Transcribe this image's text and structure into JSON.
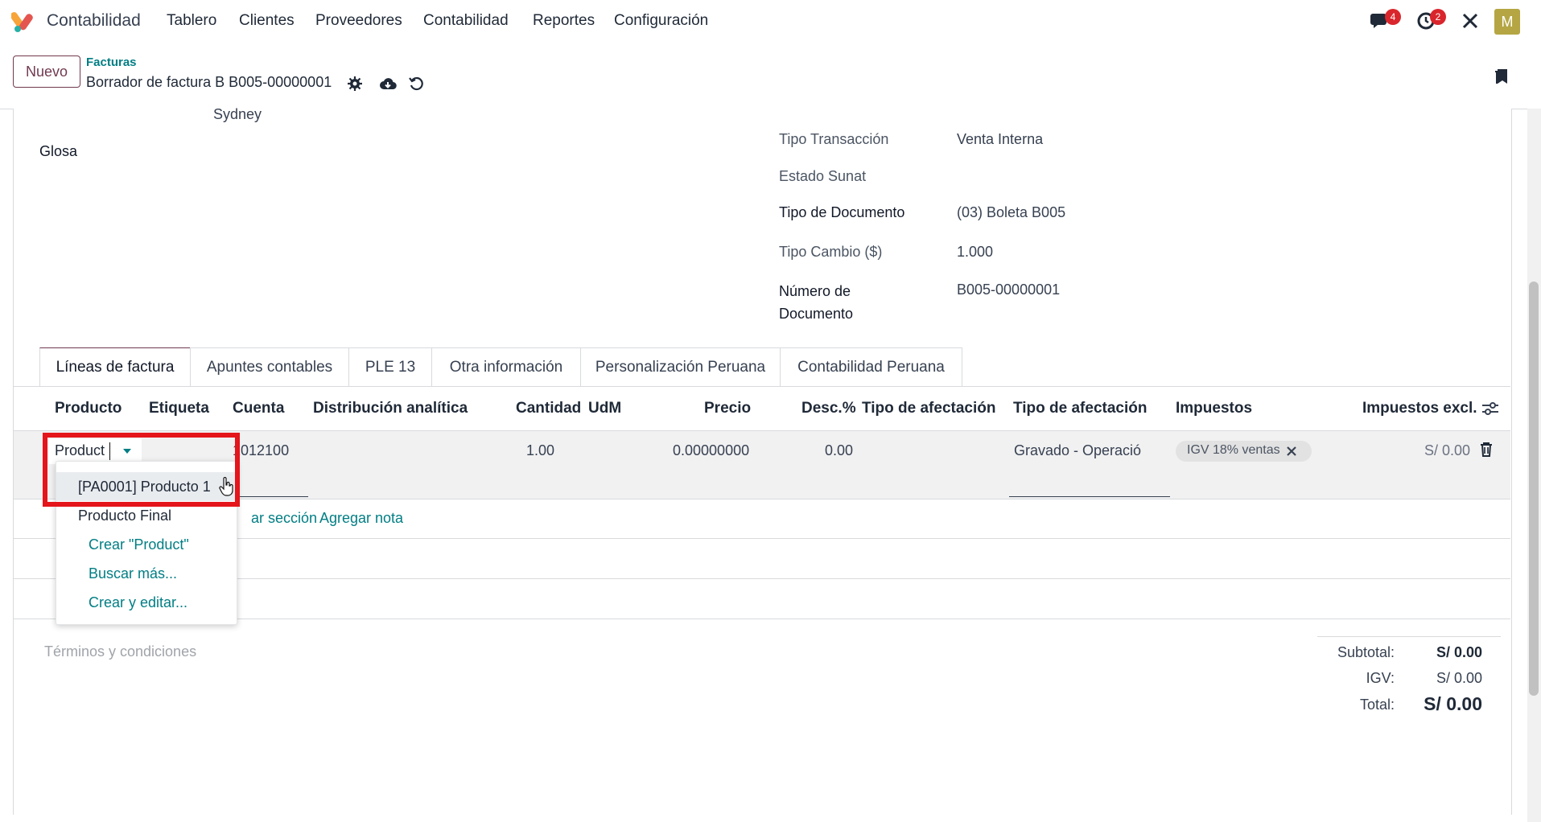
{
  "nav": {
    "app_name": "Contabilidad",
    "menu": [
      "Tablero",
      "Clientes",
      "Proveedores",
      "Contabilidad",
      "Reportes",
      "Configuración"
    ],
    "chat_badge": "4",
    "activity_badge": "2",
    "avatar_letter": "M"
  },
  "control": {
    "new_label": "Nuevo",
    "breadcrumb_parent": "Facturas",
    "record_title": "Borrador de factura B B005-00000001"
  },
  "form": {
    "city": "Sydney",
    "glosa_label": "Glosa",
    "fields": [
      {
        "label": "Tipo Transacción",
        "value": "Venta Interna"
      },
      {
        "label": "Estado Sunat",
        "value": ""
      },
      {
        "label": "Tipo de Documento",
        "value": "(03) Boleta B005"
      },
      {
        "label": "Tipo Cambio ($)",
        "value": "1.000"
      },
      {
        "label": "Número de Documento",
        "value": "B005-00000001"
      }
    ]
  },
  "tabs": [
    "Líneas de factura",
    "Apuntes contables",
    "PLE 13",
    "Otra información",
    "Personalización Peruana",
    "Contabilidad Peruana"
  ],
  "columns": [
    "Producto",
    "Etiqueta",
    "Cuenta",
    "Distribución analítica",
    "Cantidad",
    "UdM",
    "Precio",
    "Desc.%",
    "Tipo de afectación",
    "Tipo de afectación",
    "Impuestos",
    "Impuestos excl."
  ],
  "line": {
    "product_input": "Product",
    "account": "1012100",
    "quantity": "1.00",
    "price": "0.00000000",
    "discount": "0.00",
    "affectation": "Gravado - Operació",
    "tax_tag": "IGV 18% ventas",
    "subtotal": "S/ 0.00"
  },
  "dropdown": {
    "items": [
      "[PA0001] Producto 1",
      "Producto Final"
    ],
    "create": "Crear \"Product\"",
    "search_more": "Buscar más...",
    "create_edit": "Crear y editar..."
  },
  "actions": {
    "add_section": "ar sección",
    "add_note": "Agregar nota"
  },
  "terms_placeholder": "Términos y condiciones",
  "totals": {
    "subtotal_label": "Subtotal:",
    "subtotal_value": "S/ 0.00",
    "igv_label": "IGV:",
    "igv_value": "S/ 0.00",
    "total_label": "Total:",
    "total_value": "S/ 0.00"
  },
  "colors": {
    "brand": "#71394f",
    "teal": "#017e84",
    "highlight": "#e4151b"
  }
}
